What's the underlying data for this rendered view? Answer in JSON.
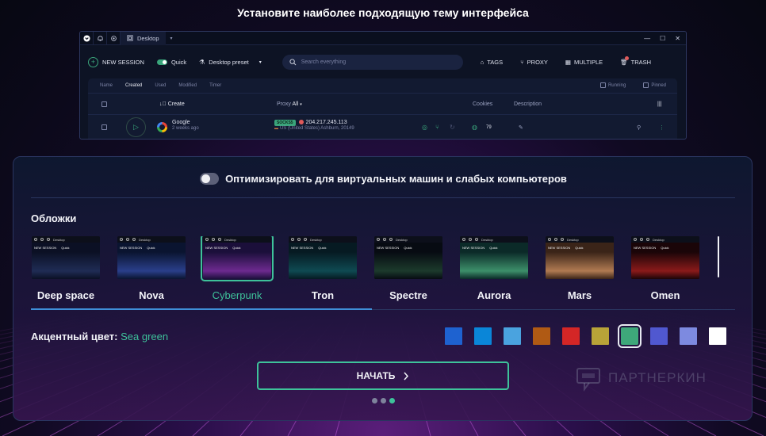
{
  "headline": "Установите наиболее подходящую тему интерфейса",
  "preview": {
    "tab_label": "Desktop",
    "toolbar": {
      "new_session": "NEW SESSION",
      "quick": "Quick",
      "preset": "Desktop preset",
      "search_placeholder": "Search everything",
      "tags": "TAGS",
      "proxy": "PROXY",
      "multiple": "MULTIPLE",
      "trash": "TRASH"
    },
    "subtabs": [
      "Name",
      "Created",
      "Used",
      "Modified",
      "Timer"
    ],
    "active_subtab": "Created",
    "filters": {
      "running": "Running",
      "pinned": "Pinned"
    },
    "columns": {
      "create": "Create",
      "proxy": "Proxy",
      "proxy_value": "All",
      "cookies": "Cookies",
      "description": "Description"
    },
    "row": {
      "name": "Google",
      "age": "2 weeks ago",
      "proxy_type": "SOCKS5",
      "ip": "204.217.245.113",
      "location": "US (United States) Ashburn, 20149",
      "cookies_count": "79"
    }
  },
  "modal": {
    "optimize_label": "Оптимизировать для виртуальных машин и слабых компьютеров",
    "optimize_enabled": false,
    "skins_title": "Обложки",
    "skins": [
      {
        "label": "Deep space",
        "bg": "#0b1024",
        "art": "#1f2c55"
      },
      {
        "label": "Nova",
        "bg": "#0a1430",
        "art": "#2a3f8a"
      },
      {
        "label": "Cyberpunk",
        "bg": "#1b0f3a",
        "art": "#6d2a8f"
      },
      {
        "label": "Tron",
        "bg": "#061a22",
        "art": "#0f4a52"
      },
      {
        "label": "Spectre",
        "bg": "#070b12",
        "art": "#1c3a2c"
      },
      {
        "label": "Aurora",
        "bg": "#0b2a28",
        "art": "#3d8f6a"
      },
      {
        "label": "Mars",
        "bg": "#3a2418",
        "art": "#b07a52"
      },
      {
        "label": "Omen",
        "bg": "#1a0508",
        "art": "#8a1a1a"
      }
    ],
    "selected_skin": "Cyberpunk",
    "mini_tab": "Desktop",
    "mini_new_session": "NEW SESSION",
    "mini_quick": "Quick",
    "accent_label": "Акцентный цвет:",
    "accent_value": "Sea green",
    "accent_colors": [
      "#1e62d0",
      "#0a86d8",
      "#4aa3df",
      "#b05a14",
      "#d42626",
      "#b8a338",
      "#3ea87a",
      "#5058d0",
      "#7d8ae0",
      "#ffffff"
    ],
    "selected_accent_index": 6,
    "start_button": "НАЧАТЬ",
    "steps": 3,
    "current_step": 3,
    "watermark": "ПАРТНЕРКИН"
  }
}
